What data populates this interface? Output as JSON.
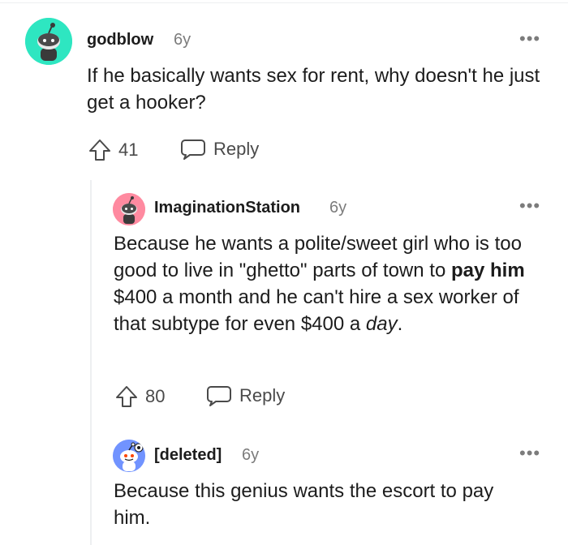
{
  "comments": [
    {
      "username": "godblow",
      "age": "6y",
      "avatar_color": "#2ee6c1",
      "body": "If he basically wants sex for rent, why doesn't he just get a hooker?",
      "votes": "41",
      "reply_label": "Reply",
      "more_label": "•••"
    },
    {
      "username": "ImaginationStation",
      "age": "6y",
      "avatar_color": "#ff8aa0",
      "body_parts": {
        "p1": "Because he wants a polite/sweet girl who is too good to live in \"ghetto\" parts of town to ",
        "bold": "pay him",
        "p2": " $400 a month and he can't hire a sex worker of that subtype for even $400 a ",
        "italic": "day",
        "p3": "."
      },
      "votes": "80",
      "reply_label": "Reply",
      "more_label": "•••"
    },
    {
      "username": "[deleted]",
      "age": "6y",
      "avatar_color": "#7193ff",
      "body": "Because this genius wants the escort to pay him.",
      "more_label": "•••"
    }
  ],
  "colors": {
    "text": "#1c1c1c",
    "meta": "#7c7c7c",
    "action": "#4a4a4a",
    "thread_line": "#edeff1"
  },
  "icons": [
    "upvote-icon",
    "chat-bubble-icon",
    "more-options-icon",
    "snoo-avatar-icon"
  ]
}
